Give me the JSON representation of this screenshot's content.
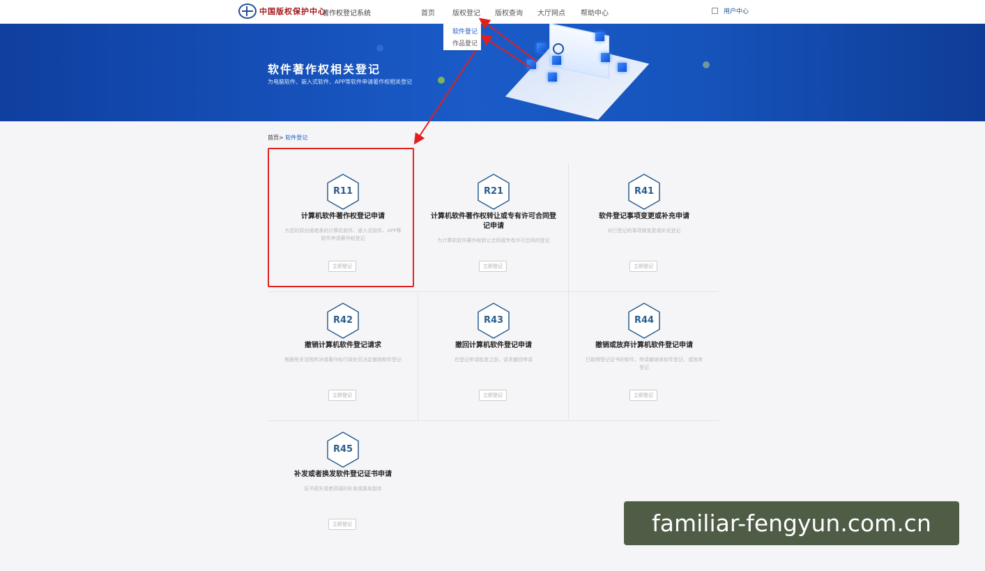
{
  "header": {
    "logo_text": "中国版权保护中心",
    "system_name": "著作权登记系统",
    "nav": [
      {
        "label": "首页"
      },
      {
        "label": "版权登记"
      },
      {
        "label": "版权查询"
      },
      {
        "label": "大厅网点"
      },
      {
        "label": "帮助中心"
      }
    ],
    "user_center": "用户中心"
  },
  "dropdown": {
    "items": [
      {
        "label": "软件登记",
        "active": true
      },
      {
        "label": "作品登记",
        "active": false
      }
    ]
  },
  "banner": {
    "title": "软件著作权相关登记",
    "subtitle": "为电脑软件、嵌入式软件、APP等软件申请著作权相关登记"
  },
  "breadcrumb": {
    "home": "首页>",
    "current": "软件登记"
  },
  "cards": [
    {
      "code": "R11",
      "title": "计算机软件著作权登记申请",
      "desc": "为您的原创或继承的计算机软件、嵌入式软件、APP等软件申请著作权登记",
      "button": "立即登记"
    },
    {
      "code": "R21",
      "title": "计算机软件著作权转让或专有许可合同登记申请",
      "desc": "为计算机软件著作权转让合同或专有许可合同的登记",
      "button": "立即登记"
    },
    {
      "code": "R41",
      "title": "软件登记事项变更或补充申请",
      "desc": "对已登记的事项做变更或补充登记",
      "button": "立即登记"
    },
    {
      "code": "R42",
      "title": "撤销计算机软件登记请求",
      "desc": "根据有关法院判决或著作权行政处罚决定撤销软件登记",
      "button": "立即登记"
    },
    {
      "code": "R43",
      "title": "撤回计算机软件登记申请",
      "desc": "在登记申请批准之前，请求撤回申请",
      "button": "立即登记"
    },
    {
      "code": "R44",
      "title": "撤销或放弃计算机软件登记申请",
      "desc": "已取得登记证书的软件，申请撤销该软件登记、或放弃登记",
      "button": "立即登记"
    },
    {
      "code": "R45",
      "title": "补发或者换发软件登记证书申请",
      "desc": "证书遗失或者损毁的补发或换发副本",
      "button": "立即登记"
    }
  ],
  "colors": {
    "accent": "#1f5fbf",
    "banner": "#1a5bc8",
    "annotation": "#e0201e",
    "hex_stroke": "#2a5d8f"
  },
  "watermark": "familiar-fengyun.com.cn"
}
